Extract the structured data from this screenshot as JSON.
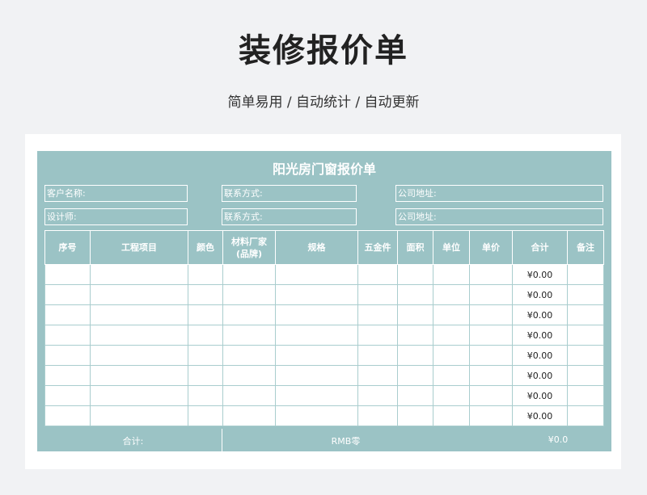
{
  "header": {
    "title": "装修报价单",
    "subtitle": "简单易用 / 自动统计 / 自动更新"
  },
  "form": {
    "title": "阳光房门窗报价单",
    "info": {
      "customer_name": "客户名称:",
      "designer": "设计师:",
      "contact_1": "联系方式:",
      "contact_2": "联系方式:",
      "company_address_1": "公司地址:",
      "company_address_2": "公司地址:"
    },
    "columns": [
      "序号",
      "工程项目",
      "颜色",
      "材料厂家\n(品牌)",
      "规格",
      "五金件",
      "面积",
      "单位",
      "单价",
      "合计",
      "备注"
    ],
    "rows": [
      {
        "total": "¥0.00"
      },
      {
        "total": "¥0.00"
      },
      {
        "total": "¥0.00"
      },
      {
        "total": "¥0.00"
      },
      {
        "total": "¥0.00"
      },
      {
        "total": "¥0.00"
      },
      {
        "total": "¥0.00"
      },
      {
        "total": "¥0.00"
      }
    ],
    "footer": {
      "total_label": "合计:",
      "rmb_label": "RMB零",
      "total_value": "¥0.0"
    }
  }
}
